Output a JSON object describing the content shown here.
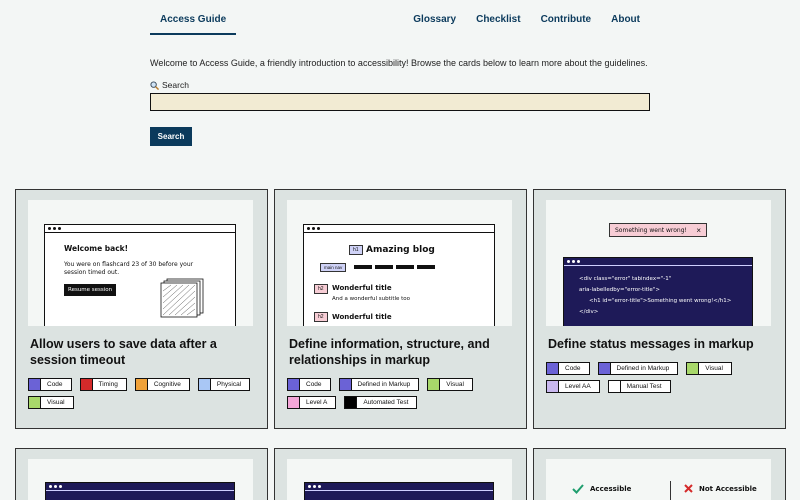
{
  "header": {
    "brand": "Access Guide",
    "nav": [
      "Glossary",
      "Checklist",
      "Contribute",
      "About"
    ]
  },
  "intro": "Welcome to Access Guide, a friendly introduction to accessibility! Browse the cards below to learn more about the guidelines.",
  "search": {
    "label": "Search",
    "icon": "magnifier-icon",
    "value": "",
    "button": "Search"
  },
  "colors": {
    "primary": "#0b3a5c",
    "card_bg": "#dce3e1",
    "input_bg": "#f2ebd3",
    "code_bg": "#1e1a58"
  },
  "cards": [
    {
      "title": "Allow users to save data after a session timeout",
      "illustration": {
        "heading": "Welcome back!",
        "text": "You were on flashcard 23 of 30 before your session timed out.",
        "button": "Resume session"
      },
      "tags": [
        {
          "label": "Code",
          "color": "#6b62d6"
        },
        {
          "label": "Timing",
          "color": "#d42a2a"
        },
        {
          "label": "Cognitive",
          "color": "#f0a23a"
        },
        {
          "label": "Physical",
          "color": "#a9c7f5"
        },
        {
          "label": "Visual",
          "color": "#a8d86a"
        }
      ]
    },
    {
      "title": "Define information, structure, and relationships in markup",
      "illustration": {
        "h1_tag": "h1",
        "h1_text": "Amazing blog",
        "nav_tag": "main nav",
        "h2_tag": "h2",
        "h2_text": "Wonderful title",
        "subtitle": "And a wonderful subtitle too",
        "h2_tag_2": "h2",
        "h2_text_2": "Wonderful title"
      },
      "tags": [
        {
          "label": "Code",
          "color": "#6b62d6"
        },
        {
          "label": "Defined in Markup",
          "color": "#6b62d6"
        },
        {
          "label": "Visual",
          "color": "#a8d86a"
        },
        {
          "label": "Level A",
          "color": "#f4a6d8"
        },
        {
          "label": "Automated Test",
          "color": "#000000"
        }
      ]
    },
    {
      "title": "Define status messages in markup",
      "illustration": {
        "alert": "Something went wrong!",
        "close": "×",
        "code_line1": "<div class=\"error\" tabindex=\"-1\"",
        "code_line2": "aria-labelledby=\"error-title\">",
        "code_line3": "<h1 id=\"error-title\">Something went wrong!</h1>",
        "code_line4": "</div>"
      },
      "tags": [
        {
          "label": "Code",
          "color": "#6b62d6"
        },
        {
          "label": "Defined in Markup",
          "color": "#6b62d6"
        },
        {
          "label": "Visual",
          "color": "#a8d86a"
        },
        {
          "label": "Level AA",
          "color": "#c9b8ef"
        },
        {
          "label": "Manual Test",
          "color": "#ffffff"
        }
      ]
    },
    {
      "title": "",
      "tags": []
    },
    {
      "title": "",
      "tags": []
    },
    {
      "title": "",
      "illustration": {
        "good": "Accessible",
        "bad": "Not Accessible"
      },
      "tags": []
    }
  ]
}
